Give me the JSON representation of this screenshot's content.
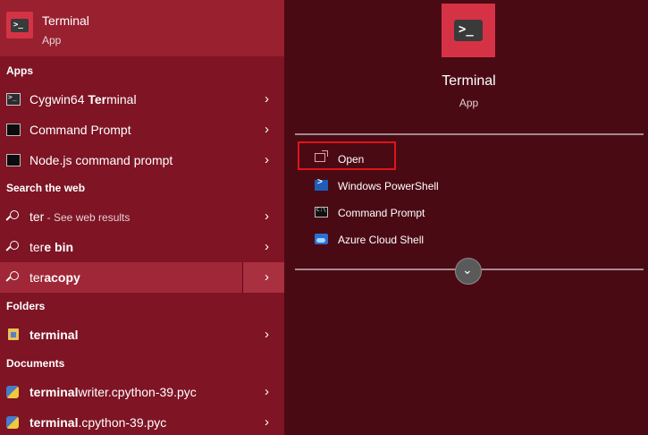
{
  "best_match": {
    "title": "Terminal",
    "type": "App"
  },
  "sections": {
    "apps": "Apps",
    "web": "Search the web",
    "folders": "Folders",
    "documents": "Documents"
  },
  "apps": [
    {
      "pre": "Cygwin64 ",
      "hl": "Ter",
      "post": "minal"
    },
    {
      "text": "Command Prompt"
    },
    {
      "text": "Node.js command prompt"
    }
  ],
  "web": [
    {
      "pre": "ter",
      "hint": " - See web results"
    },
    {
      "pre": "ter",
      "hl": "e bin"
    },
    {
      "pre": "ter",
      "hl": "acopy"
    }
  ],
  "folders": [
    {
      "hl": "terminal"
    }
  ],
  "documents": [
    {
      "hl": "terminal",
      "post": "writer.cpython-39.pyc"
    },
    {
      "hl": "terminal",
      "post": ".cpython-39.pyc"
    }
  ],
  "detail": {
    "title": "Terminal",
    "type": "App",
    "actions": [
      "Open",
      "Windows PowerShell",
      "Command Prompt",
      "Azure Cloud Shell"
    ]
  },
  "icons": {
    "chevron": "chevron-right-icon",
    "expand": "chevron-down-icon"
  },
  "colors": {
    "left_bg": "#7e1424",
    "right_bg": "#4a0a14",
    "accent": "#d63246",
    "highlight_box": "#e0141c"
  }
}
